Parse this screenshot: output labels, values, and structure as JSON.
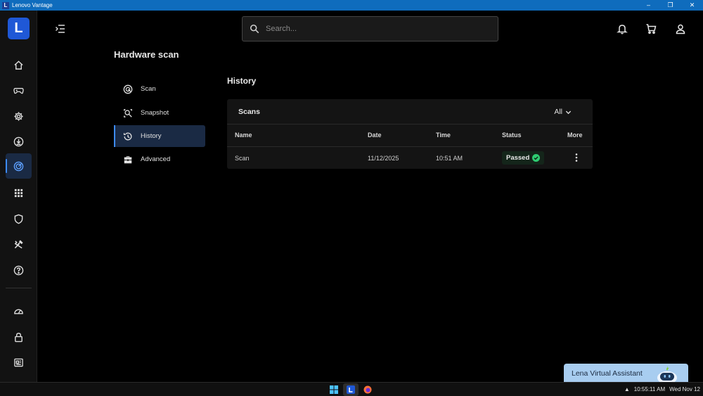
{
  "window": {
    "app_icon_letter": "L",
    "title": "Lenovo Vantage",
    "controls": [
      "–",
      "❐",
      "✕"
    ]
  },
  "rail": {
    "logo_letter": "L",
    "items": [
      {
        "icon": "home-icon"
      },
      {
        "icon": "gamepad-icon"
      },
      {
        "icon": "gear-icon"
      },
      {
        "icon": "download-icon"
      },
      {
        "icon": "hardware-scan-icon",
        "active": true
      },
      {
        "icon": "apps-grid-icon"
      },
      {
        "icon": "shield-icon"
      },
      {
        "icon": "tools-icon"
      },
      {
        "icon": "help-icon"
      },
      {
        "icon": "speedometer-icon"
      },
      {
        "icon": "lock-icon"
      },
      {
        "icon": "news-icon"
      }
    ]
  },
  "header": {
    "search_placeholder": "Search...",
    "icons": [
      "bell-icon",
      "cart-icon",
      "user-icon"
    ]
  },
  "page": {
    "title": "Hardware scan",
    "subnav": [
      {
        "label": "Scan",
        "icon": "scan-icon"
      },
      {
        "label": "Snapshot",
        "icon": "snapshot-icon"
      },
      {
        "label": "History",
        "icon": "history-icon",
        "active": true
      },
      {
        "label": "Advanced",
        "icon": "toolbox-icon"
      }
    ]
  },
  "history": {
    "section_title": "History",
    "card_title": "Scans",
    "filter_label": "All",
    "columns": [
      "Name",
      "Date",
      "Time",
      "Status",
      "More"
    ],
    "rows": [
      {
        "name": "Scan",
        "date": "11/12/2025",
        "time": "10:51 AM",
        "status": "Passed"
      }
    ]
  },
  "assistant": {
    "label": "Lena Virtual Assistant"
  },
  "taskbar": {
    "tray_arrow": "▲",
    "time": "10:55:11 AM",
    "date": "Wed Nov 12"
  },
  "colors": {
    "accent": "#3d8bff",
    "titlebar": "#0f6cbd",
    "active_bg": "#1a2a44",
    "passed": "#2ecc71",
    "assistant_bg": "#a8cdf0"
  }
}
